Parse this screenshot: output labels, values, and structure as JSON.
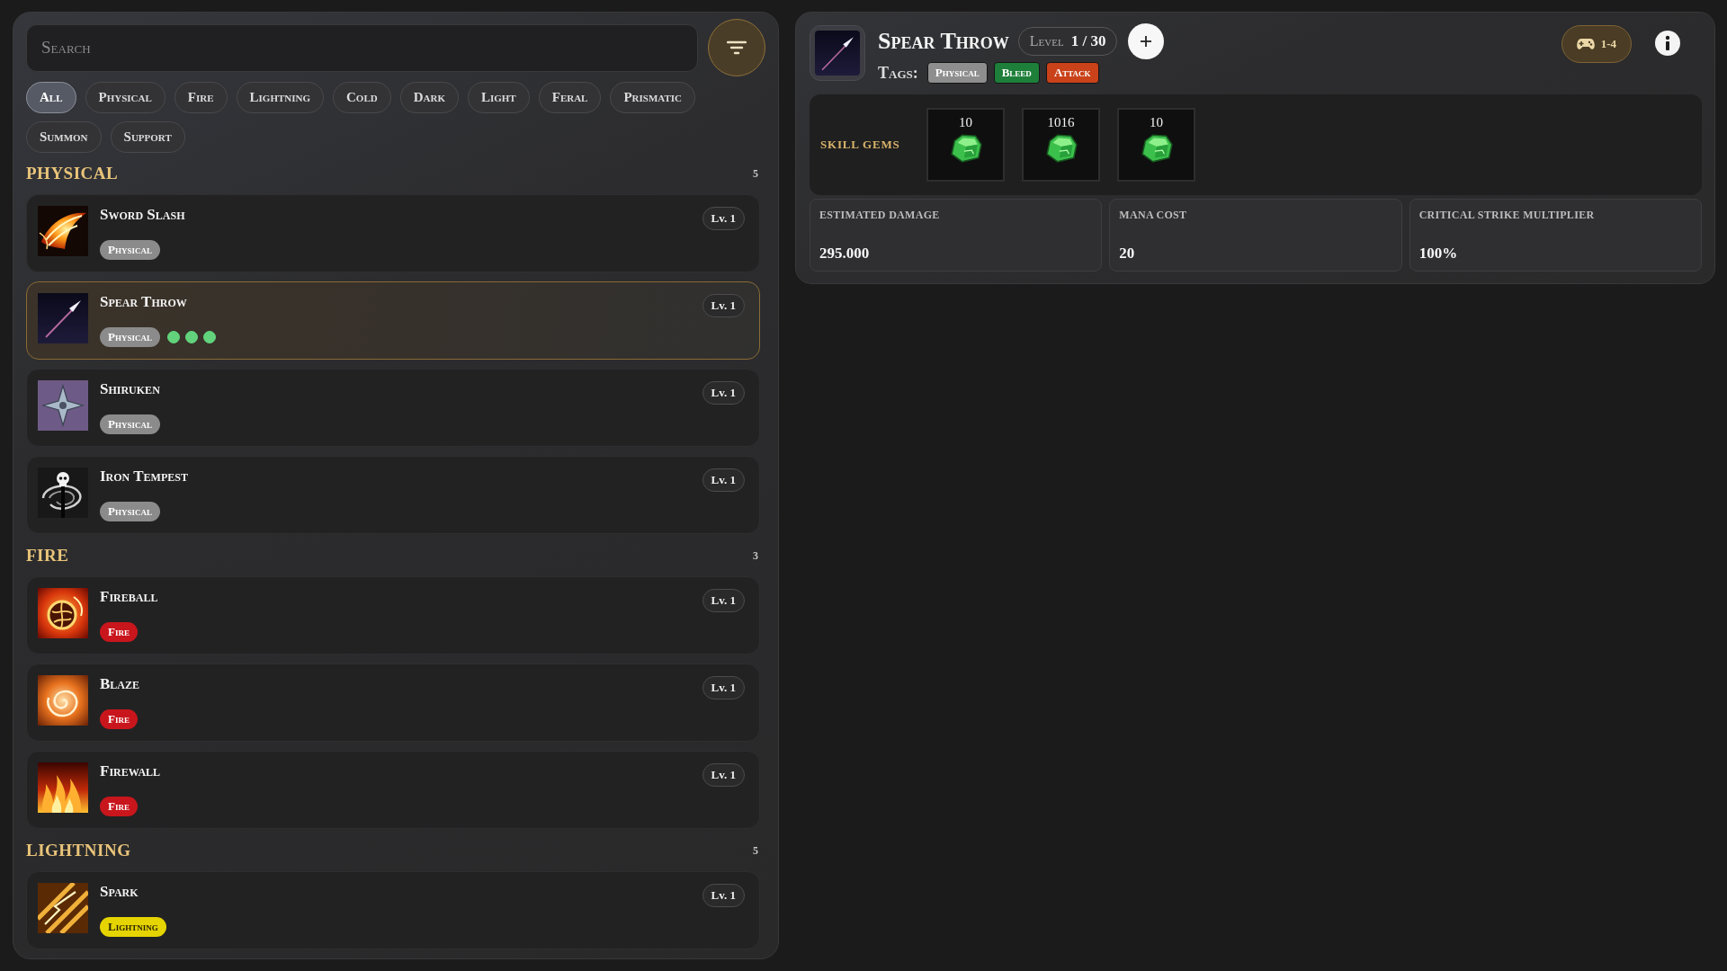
{
  "search": {
    "placeholder": "Search"
  },
  "filters": [
    {
      "label": "All",
      "selected": true
    },
    {
      "label": "Physical",
      "selected": false
    },
    {
      "label": "Fire",
      "selected": false
    },
    {
      "label": "Lightning",
      "selected": false
    },
    {
      "label": "Cold",
      "selected": false
    },
    {
      "label": "Dark",
      "selected": false
    },
    {
      "label": "Light",
      "selected": false
    },
    {
      "label": "Feral",
      "selected": false
    },
    {
      "label": "Prismatic",
      "selected": false
    },
    {
      "label": "Summon",
      "selected": false
    },
    {
      "label": "Support",
      "selected": false
    }
  ],
  "sections": [
    {
      "title": "PHYSICAL",
      "count": "5",
      "skills": [
        {
          "name": "Sword Slash",
          "kind": "slash",
          "lv": "Lv. 1",
          "selected": false,
          "tags": [
            {
              "label": "Physical",
              "color": "#8b8b8b"
            }
          ]
        },
        {
          "name": "Spear Throw",
          "kind": "spear",
          "lv": "Lv. 1",
          "selected": true,
          "tags": [
            {
              "label": "Physical",
              "color": "#8b8b8b"
            }
          ],
          "sockets": [
            {
              "filled": true
            },
            {
              "filled": true
            },
            {
              "filled": true
            }
          ]
        },
        {
          "name": "Shiruken",
          "kind": "shuriken",
          "lv": "Lv. 1",
          "selected": false,
          "tags": [
            {
              "label": "Physical",
              "color": "#8b8b8b"
            }
          ]
        },
        {
          "name": "Iron Tempest",
          "kind": "vortex",
          "lv": "Lv. 1",
          "selected": false,
          "tags": [
            {
              "label": "Physical",
              "color": "#8b8b8b"
            }
          ]
        }
      ]
    },
    {
      "title": "FIRE",
      "count": "3",
      "skills": [
        {
          "name": "Fireball",
          "kind": "fireball",
          "lv": "Lv. 1",
          "selected": false,
          "tags": [
            {
              "label": "Fire",
              "color": "#c8161c"
            }
          ]
        },
        {
          "name": "Blaze",
          "kind": "swirl",
          "lv": "Lv. 1",
          "selected": false,
          "tags": [
            {
              "label": "Fire",
              "color": "#c8161c"
            }
          ]
        },
        {
          "name": "Firewall",
          "kind": "flames",
          "lv": "Lv. 1",
          "selected": false,
          "tags": [
            {
              "label": "Fire",
              "color": "#c8161c"
            }
          ]
        }
      ]
    },
    {
      "title": "LIGHTNING",
      "count": "5",
      "skills": [
        {
          "name": "Spark",
          "kind": "bolt",
          "lv": "Lv. 1",
          "selected": false,
          "tags": [
            {
              "label": "Lightning",
              "color": "#e6d400"
            }
          ]
        }
      ]
    }
  ],
  "detail": {
    "kind": "spear",
    "title": "Spear Throw",
    "level_pill": {
      "label": "Level",
      "value": "1 / 30"
    },
    "players": "1-4",
    "tags_label": "Tags:",
    "tags": [
      {
        "label": "Physical",
        "color": "#8e8e8e"
      },
      {
        "label": "Bleed",
        "color": "#1e7f3a"
      },
      {
        "label": "Attack",
        "color": "#c9421a"
      }
    ],
    "gems": {
      "label": "SKILL GEMS",
      "slots": [
        {
          "count": "10"
        },
        {
          "count": "1016"
        },
        {
          "count": "10"
        }
      ]
    },
    "stats": [
      {
        "label": "ESTIMATED DAMAGE",
        "value": "295.000"
      },
      {
        "label": "MANA COST",
        "value": "20"
      },
      {
        "label": "CRITICAL STRIKE MULTIPLIER",
        "value": "100%"
      }
    ]
  }
}
